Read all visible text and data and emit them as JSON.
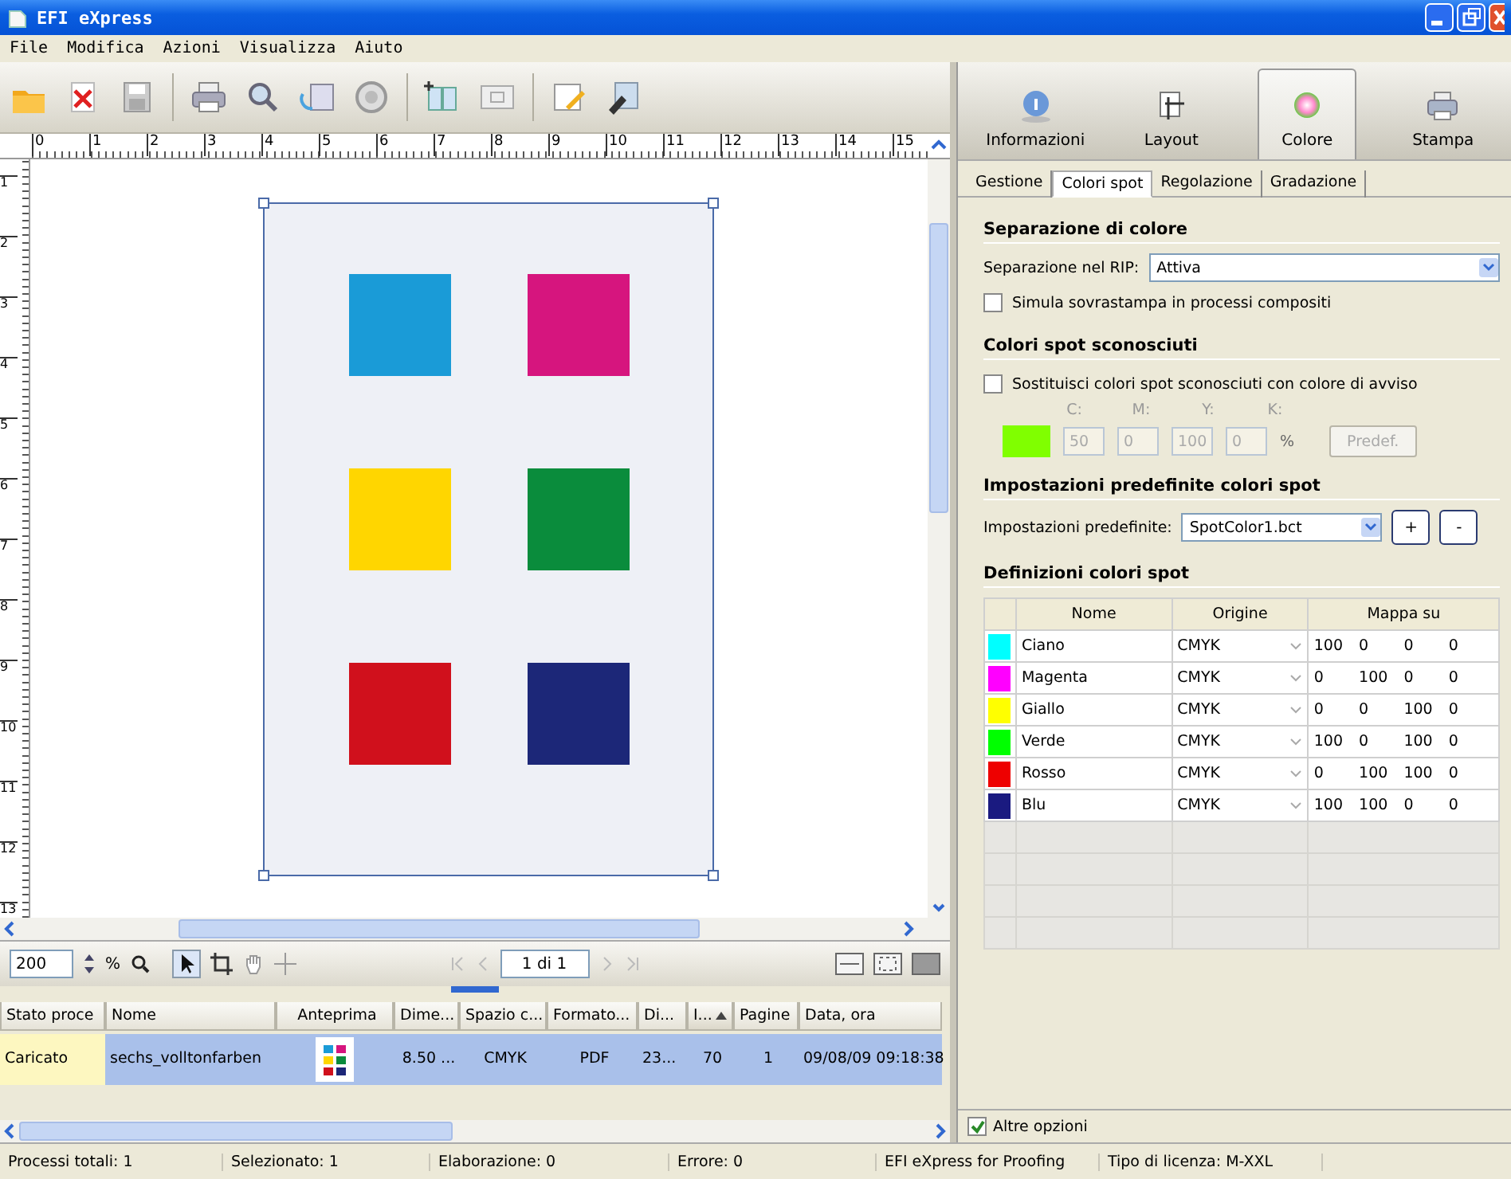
{
  "window": {
    "title": "EFI eXpress"
  },
  "menu": [
    "File",
    "Modifica",
    "Azioni",
    "Visualizza",
    "Aiuto"
  ],
  "ruler": {
    "horizontal": [
      "0",
      "1",
      "2",
      "3",
      "4",
      "5",
      "6",
      "7",
      "8",
      "9",
      "10",
      "11",
      "12",
      "13",
      "14",
      "15"
    ],
    "vertical": [
      "1",
      "2",
      "3",
      "4",
      "5",
      "6",
      "7",
      "8",
      "9",
      "10",
      "11",
      "12",
      "13"
    ]
  },
  "document": {
    "swatches": [
      {
        "color": "#1a9bd7"
      },
      {
        "color": "#d6157e"
      },
      {
        "color": "#ffd600"
      },
      {
        "color": "#0a8c3c"
      },
      {
        "color": "#d0101c"
      },
      {
        "color": "#1c2778"
      }
    ]
  },
  "view_toolbar": {
    "zoom": "200",
    "unit": "%",
    "page": "1 di 1"
  },
  "jobs": {
    "columns": [
      {
        "label": "Stato proce",
        "sorted": false
      },
      {
        "label": "Nome",
        "sorted": false
      },
      {
        "label": "Anteprima",
        "sorted": false
      },
      {
        "label": "Dime...",
        "sorted": false
      },
      {
        "label": "Spazio c...",
        "sorted": false
      },
      {
        "label": "Formato...",
        "sorted": false
      },
      {
        "label": "Di...",
        "sorted": false
      },
      {
        "label": "I...",
        "sorted": true
      },
      {
        "label": "Pagine",
        "sorted": false
      },
      {
        "label": "Data, ora",
        "sorted": false
      }
    ],
    "rows": [
      {
        "selected": true,
        "cells": [
          "Caricato",
          "sechs_volltonfarben",
          "",
          "8.50 ...",
          "CMYK",
          "PDF",
          "23...",
          "70",
          "1",
          "09/08/09 09:18:38"
        ]
      }
    ]
  },
  "panel": {
    "tabs": [
      {
        "label": "Informazioni",
        "kind": "info",
        "selected": false
      },
      {
        "label": "Layout",
        "kind": "layout",
        "selected": false
      },
      {
        "label": "Colore",
        "kind": "color",
        "selected": true
      },
      {
        "label": "Stampa",
        "kind": "print",
        "selected": false
      }
    ],
    "subtabs": [
      {
        "label": "Gestione",
        "selected": false
      },
      {
        "label": "Colori spot",
        "selected": true
      },
      {
        "label": "Regolazione",
        "selected": false
      },
      {
        "label": "Gradazione",
        "selected": false
      }
    ],
    "separation": {
      "heading": "Separazione di colore",
      "label": "Separazione nel RIP:",
      "value": "Attiva",
      "overprint": {
        "label": "Simula sovrastampa in processi compositi",
        "checked": false
      }
    },
    "unknown": {
      "heading": "Colori spot sconosciuti",
      "replace": {
        "label": "Sostituisci colori spot sconosciuti con colore di avviso",
        "checked": false
      },
      "channels": [
        {
          "label": "C:",
          "value": "50"
        },
        {
          "label": "M:",
          "value": "0"
        },
        {
          "label": "Y:",
          "value": "100"
        },
        {
          "label": "K:",
          "value": "0"
        }
      ],
      "unit": "%",
      "default_button": "Predef.",
      "disabled": true
    },
    "presets": {
      "heading": "Impostazioni predefinite colori spot",
      "label": "Impostazioni predefinite:",
      "value": "SpotColor1.bct",
      "add": "+",
      "remove": "-"
    },
    "definitions": {
      "heading": "Definizioni colori spot",
      "columns": [
        "Nome",
        "Origine",
        "Mappa su"
      ],
      "rows": [
        {
          "color": "#00ffff",
          "name": "Ciano",
          "origin": "CMYK",
          "map": [
            "100",
            "0",
            "0",
            "0"
          ]
        },
        {
          "color": "#ff00ff",
          "name": "Magenta",
          "origin": "CMYK",
          "map": [
            "0",
            "100",
            "0",
            "0"
          ]
        },
        {
          "color": "#ffff00",
          "name": "Giallo",
          "origin": "CMYK",
          "map": [
            "0",
            "0",
            "100",
            "0"
          ]
        },
        {
          "color": "#00ff00",
          "name": "Verde",
          "origin": "CMYK",
          "map": [
            "100",
            "0",
            "100",
            "0"
          ]
        },
        {
          "color": "#ee0000",
          "name": "Rosso",
          "origin": "CMYK",
          "map": [
            "0",
            "100",
            "100",
            "0"
          ]
        },
        {
          "color": "#1a1a80",
          "name": "Blu",
          "origin": "CMYK",
          "map": [
            "100",
            "100",
            "0",
            "0"
          ]
        }
      ]
    },
    "more_options": {
      "label": "Altre opzioni",
      "checked": true
    }
  },
  "status_bar": [
    "Processi totali: 1",
    "Selezionato: 1",
    "Elaborazione: 0",
    "Errore: 0",
    "EFI eXpress for Proofing",
    "Tipo di licenza: M-XXL"
  ]
}
